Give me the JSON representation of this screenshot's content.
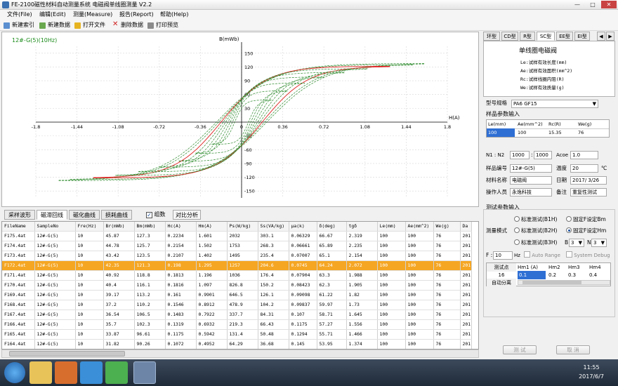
{
  "window": {
    "title": "FE-2100磁性材料自动测量系统 电磁阀单线圈测量 V2.2",
    "min": "—",
    "max": "□",
    "close": "✕"
  },
  "menu": [
    "文件(File)",
    "编辑(Edit)",
    "测量(Measure)",
    "报告(Report)",
    "帮助(Help)"
  ],
  "toolbar": [
    "新建索引",
    "新建数据",
    "打开文件",
    "删除数据",
    "打印预览"
  ],
  "chart": {
    "series_label": "12#-G(5)(10Hz)",
    "y_label": "B(mWb)",
    "x_label": "H(A)",
    "x_ticks": [
      "-1.8",
      "-1.44",
      "-1.08",
      "-0.72",
      "-0.36",
      "0",
      "0.36",
      "0.72",
      "1.08",
      "1.44",
      "1.8"
    ],
    "y_ticks": [
      "150",
      "120",
      "90",
      "60",
      "30",
      "-30",
      "-60",
      "-90",
      "-120",
      "-150"
    ]
  },
  "chart_data": {
    "type": "line",
    "title": "12#-G(5)(10Hz)",
    "xlabel": "H(A)",
    "ylabel": "B(mWb)",
    "xlim": [
      -1.8,
      1.8
    ],
    "ylim": [
      -165,
      165
    ],
    "loops": [
      {
        "hc": 0.22,
        "bm": 127.3,
        "hm": 1.6
      },
      {
        "hc": 0.2,
        "bm": 125.0,
        "hm": 1.5
      },
      {
        "hc": 0.18,
        "bm": 121.3,
        "hm": 1.295
      },
      {
        "hc": 0.16,
        "bm": 116.0,
        "hm": 1.1
      },
      {
        "hc": 0.14,
        "bm": 108.0,
        "hm": 0.9
      },
      {
        "hc": 0.12,
        "bm": 98.0,
        "hm": 0.72
      },
      {
        "hc": 0.1,
        "bm": 85.0,
        "hm": 0.55
      },
      {
        "hc": 0.08,
        "bm": 68.0,
        "hm": 0.4
      },
      {
        "hc": 0.06,
        "bm": 48.0,
        "hm": 0.26
      }
    ],
    "colors": {
      "loops": "#2e8b2e",
      "selected": "#e02020"
    }
  },
  "tabs": [
    "采样波形",
    "磁滞回线",
    "磁化曲线",
    "损耗曲线"
  ],
  "active_tab": "磁滞回线",
  "options": {
    "group_label": "组数",
    "group_checked": "✓",
    "compare_button": "对比分析"
  },
  "table": {
    "columns": [
      "FileName",
      "SampleNo",
      "Fre(Hz)",
      "Br(mWb)",
      "Bm(mWb)",
      "Hc(A)",
      "Hm(A)",
      "Ps(W/kg)",
      "Ss(VA/kg)",
      "μa(k)",
      "δ(deg)",
      "tgδ",
      "Le(mm)",
      "Ae(mm^2)",
      "We(g)",
      "Da"
    ],
    "rows": [
      [
        "F175.4at",
        "12#-G(5)",
        "10",
        "45.87",
        "127.3",
        "0.2234",
        "1.601",
        "2032",
        "303.1",
        "0.06329",
        "66.67",
        "2.319",
        "100",
        "100",
        "76",
        "201"
      ],
      [
        "F174.4at",
        "12#-G(5)",
        "10",
        "44.78",
        "125.7",
        "0.2154",
        "1.502",
        "1753",
        "268.3",
        "0.06661",
        "65.89",
        "2.235",
        "100",
        "100",
        "76",
        "201"
      ],
      [
        "F173.4at",
        "12#-G(5)",
        "10",
        "43.42",
        "123.5",
        "0.2107",
        "1.402",
        "1495",
        "235.4",
        "0.07007",
        "65.1",
        "2.154",
        "100",
        "100",
        "76",
        "201"
      ],
      [
        "F172.4at",
        "12#-G(5)",
        "10",
        "42.35",
        "121.3",
        "0.198",
        "1.295",
        "1257",
        "204.6",
        "0.0745",
        "64.24",
        "2.072",
        "100",
        "100",
        "76",
        "201"
      ],
      [
        "F171.4at",
        "12#-G(5)",
        "10",
        "40.92",
        "118.8",
        "0.1813",
        "1.196",
        "1036",
        "176.4",
        "0.07904",
        "63.3",
        "1.988",
        "100",
        "100",
        "76",
        "201"
      ],
      [
        "F170.4at",
        "12#-G(5)",
        "10",
        "40.4",
        "116.1",
        "0.1816",
        "1.097",
        "826.8",
        "150.2",
        "0.08423",
        "62.3",
        "1.905",
        "100",
        "100",
        "76",
        "201"
      ],
      [
        "F169.4at",
        "12#-G(5)",
        "10",
        "39.17",
        "113.2",
        "0.161",
        "0.9901",
        "646.5",
        "126.1",
        "0.09098",
        "61.22",
        "1.82",
        "100",
        "100",
        "76",
        "201"
      ],
      [
        "F168.4at",
        "12#-G(5)",
        "10",
        "37.2",
        "110.2",
        "0.1546",
        "0.8912",
        "478.9",
        "104.2",
        "0.09837",
        "59.97",
        "1.73",
        "100",
        "100",
        "76",
        "201"
      ],
      [
        "F167.4at",
        "12#-G(5)",
        "10",
        "36.54",
        "106.5",
        "0.1483",
        "0.7922",
        "337.7",
        "84.31",
        "0.107",
        "58.71",
        "1.645",
        "100",
        "100",
        "76",
        "201"
      ],
      [
        "F166.4at",
        "12#-G(5)",
        "10",
        "35.7",
        "102.3",
        "0.1319",
        "0.6932",
        "219.3",
        "66.43",
        "0.1175",
        "57.27",
        "1.556",
        "100",
        "100",
        "76",
        "201"
      ],
      [
        "F165.4at",
        "12#-G(5)",
        "10",
        "33.87",
        "96.61",
        "0.1175",
        "0.5942",
        "131.4",
        "50.48",
        "0.1294",
        "55.71",
        "1.466",
        "100",
        "100",
        "76",
        "201"
      ],
      [
        "F164.4at",
        "12#-G(5)",
        "10",
        "31.82",
        "90.26",
        "0.1072",
        "0.4952",
        "64.29",
        "36.68",
        "0.145",
        "53.95",
        "1.374",
        "100",
        "100",
        "76",
        "201"
      ]
    ],
    "selected_index": 3
  },
  "right_tabs": [
    "环型",
    "CD型",
    "R型",
    "SC型",
    "EE型",
    "EI型"
  ],
  "right_active_tab": "SC型",
  "sample_type": {
    "title": "单线圈电磁阀",
    "lines": [
      "Le:试样有效长度(mm)",
      "Ae:试样有效面积(mm^2)",
      "Rc:试样线圈内阻(R)",
      "We:试样有效质量(g)"
    ]
  },
  "model_spec": {
    "label": "型号规格",
    "value": "PA6 GF15",
    "arrow": "▼"
  },
  "sample_params": {
    "title": "样品参数输入",
    "headers": [
      "Le(mm)",
      "Ae(mm^2)",
      "Rc(R)",
      "We(g)"
    ],
    "values": [
      "100",
      "100",
      "15.35",
      "76"
    ]
  },
  "fields": {
    "n_label": "N1 : N2",
    "n1": "1000",
    "n2": "1000",
    "n_sep": ":",
    "acoe_label": "Acoe",
    "acoe": "1.0",
    "sample_no_label": "样品编号",
    "sample_no": "12#-G(5)",
    "temp_label": "温度",
    "temp": "20",
    "temp_unit": "℃",
    "material_label": "材料名称",
    "material": "电磁阀",
    "date_label": "日期",
    "date": "2017/ 3/26",
    "operator_label": "操作人员",
    "operator": "永逸科技",
    "note_label": "备注",
    "note": "重复性测试"
  },
  "test_params": {
    "title": "测试参数输入",
    "mode_label": "测量模式",
    "modes": [
      "标准测试(B1H)",
      "标准测试(B2H)",
      "标准测试(B3H)"
    ],
    "fixed": [
      "固定F设定Bm",
      "固定F设定Hm"
    ],
    "b_label": "B",
    "b_value": "3",
    "n_label": "N",
    "n_value": "3",
    "f_label": "F :",
    "f_value": "10",
    "f_unit": "Hz",
    "auto_range": "Auto Range",
    "system_debug": "System Debug",
    "grid_headers": [
      "测试点",
      "Hm1 (A)",
      "Hm2",
      "Hm3",
      "Hm4"
    ],
    "grid_row": [
      "16",
      "0.1",
      "0.2",
      "0.3",
      "0.4"
    ],
    "auto_label": "自动分离"
  },
  "buttons": {
    "test": "测 试",
    "cancel": "取 消"
  },
  "clock": {
    "time": "11:55",
    "date": "2017/6/7"
  },
  "colors": {
    "selected_row": "#f5a623",
    "curve": "#2e8b2e",
    "label_green": "#1a8a1a"
  }
}
